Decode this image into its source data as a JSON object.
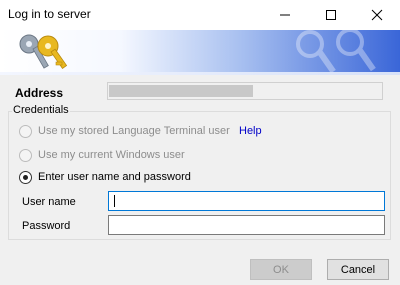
{
  "window": {
    "title": "Log in to server",
    "minimize_icon": "minimize-icon",
    "maximize_icon": "maximize-icon",
    "close_icon": "close-icon"
  },
  "banner": {
    "icon": "keys-icon"
  },
  "address": {
    "label": "Address",
    "value": ""
  },
  "credentials": {
    "group_title": "Credentials",
    "options": [
      {
        "label": "Use my stored Language Terminal user",
        "enabled": false,
        "selected": false
      },
      {
        "label": "Use my current Windows user",
        "enabled": false,
        "selected": false
      },
      {
        "label": "Enter user name and password",
        "enabled": true,
        "selected": true
      }
    ],
    "help_link": "Help",
    "username_label": "User name",
    "username_value": "",
    "password_label": "Password",
    "password_value": ""
  },
  "buttons": {
    "ok": "OK",
    "cancel": "Cancel"
  },
  "colors": {
    "banner_blue": "#3a66d8",
    "link": "#0000c8",
    "focus": "#0078d7"
  }
}
